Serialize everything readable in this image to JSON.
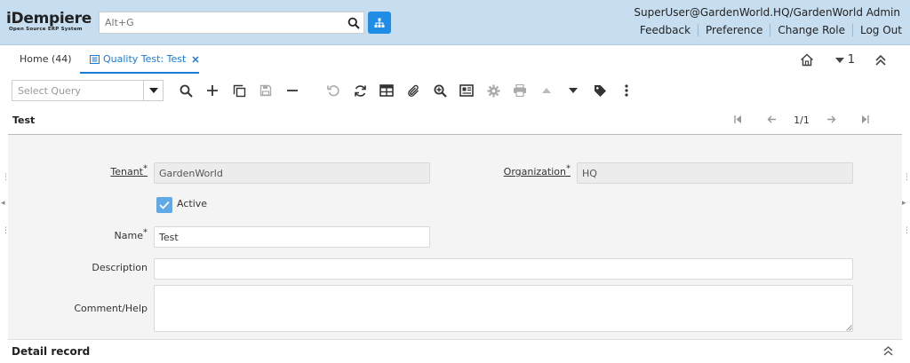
{
  "header": {
    "logo_text": "iDempiere",
    "logo_tagline": "Open Source ERP System",
    "search_placeholder": "Alt+G",
    "user_context": "SuperUser@GardenWorld.HQ/GardenWorld Admin",
    "links": [
      "Feedback",
      "Preference",
      "Change Role",
      "Log Out"
    ]
  },
  "tabs": {
    "home_label": "Home (44)",
    "active_label": "Quality Test: Test",
    "window_count": "1"
  },
  "toolbar": {
    "query_placeholder": "Select Query",
    "icons": [
      "search-icon",
      "new-icon",
      "copy-icon",
      "save-icon",
      "delete-icon",
      "undo-icon",
      "refresh-icon",
      "grid-toggle-icon",
      "attachment-icon",
      "zoom-across-icon",
      "report-icon",
      "process-icon",
      "print-icon",
      "parent-icon",
      "detail-icon",
      "lock-icon",
      "more-icon"
    ]
  },
  "window": {
    "title": "Test",
    "record_position": "1/1"
  },
  "form": {
    "tenant_label": "Tenant",
    "tenant_value": "GardenWorld",
    "organization_label": "Organization",
    "organization_value": "HQ",
    "active_label": "Active",
    "active_checked": true,
    "name_label": "Name",
    "name_value": "Test",
    "description_label": "Description",
    "description_value": "",
    "comment_label": "Comment/Help",
    "comment_value": ""
  },
  "detail": {
    "title": "Detail record"
  },
  "colors": {
    "header_bg": "#c7def0",
    "accent": "#1a7cd6",
    "tree_button": "#1f8ce6"
  }
}
